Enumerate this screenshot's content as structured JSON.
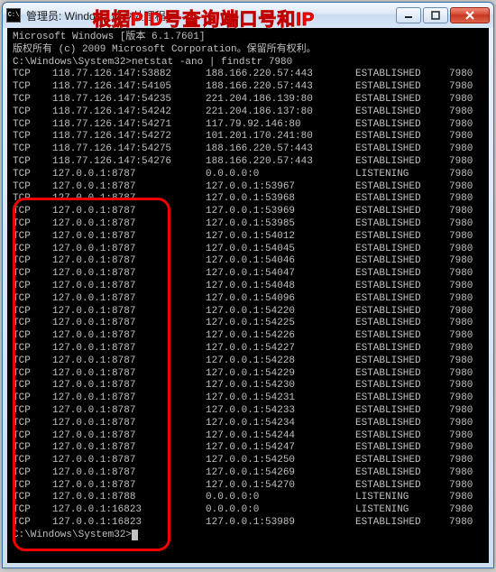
{
  "window": {
    "title_prefix": "管理员: Windows 命令处理程序",
    "icon_label": "C:\\"
  },
  "annotation": "根据PID号查询端口号和IP",
  "header_lines": [
    "Microsoft Windows [版本 6.1.7601]",
    "版权所有 (c) 2009 Microsoft Corporation。保留所有权利。",
    ""
  ],
  "command_prompt": "C:\\Windows\\System32>",
  "command": "netstat -ano | findstr 7980",
  "rows": [
    {
      "proto": "TCP",
      "local": "118.77.126.147:53882",
      "remote": "188.166.220.57:443",
      "state": "ESTABLISHED",
      "pid": "7980"
    },
    {
      "proto": "TCP",
      "local": "118.77.126.147:54105",
      "remote": "188.166.220.57:443",
      "state": "ESTABLISHED",
      "pid": "7980"
    },
    {
      "proto": "TCP",
      "local": "118.77.126.147:54235",
      "remote": "221.204.186.139:80",
      "state": "ESTABLISHED",
      "pid": "7980"
    },
    {
      "proto": "TCP",
      "local": "118.77.126.147:54242",
      "remote": "221.204.186.137:80",
      "state": "ESTABLISHED",
      "pid": "7980"
    },
    {
      "proto": "TCP",
      "local": "118.77.126.147:54271",
      "remote": "117.79.92.146:80",
      "state": "ESTABLISHED",
      "pid": "7980"
    },
    {
      "proto": "TCP",
      "local": "118.77.126.147:54272",
      "remote": "101.201.170.241:80",
      "state": "ESTABLISHED",
      "pid": "7980"
    },
    {
      "proto": "TCP",
      "local": "118.77.126.147:54275",
      "remote": "188.166.220.57:443",
      "state": "ESTABLISHED",
      "pid": "7980"
    },
    {
      "proto": "TCP",
      "local": "118.77.126.147:54276",
      "remote": "188.166.220.57:443",
      "state": "ESTABLISHED",
      "pid": "7980"
    },
    {
      "proto": "TCP",
      "local": "127.0.0.1:8787",
      "remote": "0.0.0.0:0",
      "state": "LISTENING",
      "pid": "7980"
    },
    {
      "proto": "TCP",
      "local": "127.0.0.1:8787",
      "remote": "127.0.0.1:53967",
      "state": "ESTABLISHED",
      "pid": "7980"
    },
    {
      "proto": "TCP",
      "local": "127.0.0.1:8787",
      "remote": "127.0.0.1:53968",
      "state": "ESTABLISHED",
      "pid": "7980"
    },
    {
      "proto": "TCP",
      "local": "127.0.0.1:8787",
      "remote": "127.0.0.1:53969",
      "state": "ESTABLISHED",
      "pid": "7980"
    },
    {
      "proto": "TCP",
      "local": "127.0.0.1:8787",
      "remote": "127.0.0.1:53985",
      "state": "ESTABLISHED",
      "pid": "7980"
    },
    {
      "proto": "TCP",
      "local": "127.0.0.1:8787",
      "remote": "127.0.0.1:54012",
      "state": "ESTABLISHED",
      "pid": "7980"
    },
    {
      "proto": "TCP",
      "local": "127.0.0.1:8787",
      "remote": "127.0.0.1:54045",
      "state": "ESTABLISHED",
      "pid": "7980"
    },
    {
      "proto": "TCP",
      "local": "127.0.0.1:8787",
      "remote": "127.0.0.1:54046",
      "state": "ESTABLISHED",
      "pid": "7980"
    },
    {
      "proto": "TCP",
      "local": "127.0.0.1:8787",
      "remote": "127.0.0.1:54047",
      "state": "ESTABLISHED",
      "pid": "7980"
    },
    {
      "proto": "TCP",
      "local": "127.0.0.1:8787",
      "remote": "127.0.0.1:54048",
      "state": "ESTABLISHED",
      "pid": "7980"
    },
    {
      "proto": "TCP",
      "local": "127.0.0.1:8787",
      "remote": "127.0.0.1:54096",
      "state": "ESTABLISHED",
      "pid": "7980"
    },
    {
      "proto": "TCP",
      "local": "127.0.0.1:8787",
      "remote": "127.0.0.1:54220",
      "state": "ESTABLISHED",
      "pid": "7980"
    },
    {
      "proto": "TCP",
      "local": "127.0.0.1:8787",
      "remote": "127.0.0.1:54225",
      "state": "ESTABLISHED",
      "pid": "7980"
    },
    {
      "proto": "TCP",
      "local": "127.0.0.1:8787",
      "remote": "127.0.0.1:54226",
      "state": "ESTABLISHED",
      "pid": "7980"
    },
    {
      "proto": "TCP",
      "local": "127.0.0.1:8787",
      "remote": "127.0.0.1:54227",
      "state": "ESTABLISHED",
      "pid": "7980"
    },
    {
      "proto": "TCP",
      "local": "127.0.0.1:8787",
      "remote": "127.0.0.1:54228",
      "state": "ESTABLISHED",
      "pid": "7980"
    },
    {
      "proto": "TCP",
      "local": "127.0.0.1:8787",
      "remote": "127.0.0.1:54229",
      "state": "ESTABLISHED",
      "pid": "7980"
    },
    {
      "proto": "TCP",
      "local": "127.0.0.1:8787",
      "remote": "127.0.0.1:54230",
      "state": "ESTABLISHED",
      "pid": "7980"
    },
    {
      "proto": "TCP",
      "local": "127.0.0.1:8787",
      "remote": "127.0.0.1:54231",
      "state": "ESTABLISHED",
      "pid": "7980"
    },
    {
      "proto": "TCP",
      "local": "127.0.0.1:8787",
      "remote": "127.0.0.1:54233",
      "state": "ESTABLISHED",
      "pid": "7980"
    },
    {
      "proto": "TCP",
      "local": "127.0.0.1:8787",
      "remote": "127.0.0.1:54234",
      "state": "ESTABLISHED",
      "pid": "7980"
    },
    {
      "proto": "TCP",
      "local": "127.0.0.1:8787",
      "remote": "127.0.0.1:54244",
      "state": "ESTABLISHED",
      "pid": "7980"
    },
    {
      "proto": "TCP",
      "local": "127.0.0.1:8787",
      "remote": "127.0.0.1:54247",
      "state": "ESTABLISHED",
      "pid": "7980"
    },
    {
      "proto": "TCP",
      "local": "127.0.0.1:8787",
      "remote": "127.0.0.1:54250",
      "state": "ESTABLISHED",
      "pid": "7980"
    },
    {
      "proto": "TCP",
      "local": "127.0.0.1:8787",
      "remote": "127.0.0.1:54269",
      "state": "ESTABLISHED",
      "pid": "7980"
    },
    {
      "proto": "TCP",
      "local": "127.0.0.1:8787",
      "remote": "127.0.0.1:54270",
      "state": "ESTABLISHED",
      "pid": "7980"
    },
    {
      "proto": "TCP",
      "local": "127.0.0.1:8788",
      "remote": "0.0.0.0:0",
      "state": "LISTENING",
      "pid": "7980"
    },
    {
      "proto": "TCP",
      "local": "127.0.0.1:16823",
      "remote": "0.0.0.0:0",
      "state": "LISTENING",
      "pid": "7980"
    },
    {
      "proto": "TCP",
      "local": "127.0.0.1:16823",
      "remote": "127.0.0.1:53989",
      "state": "ESTABLISHED",
      "pid": "7980"
    }
  ],
  "final_prompt": "C:\\Windows\\System32>"
}
